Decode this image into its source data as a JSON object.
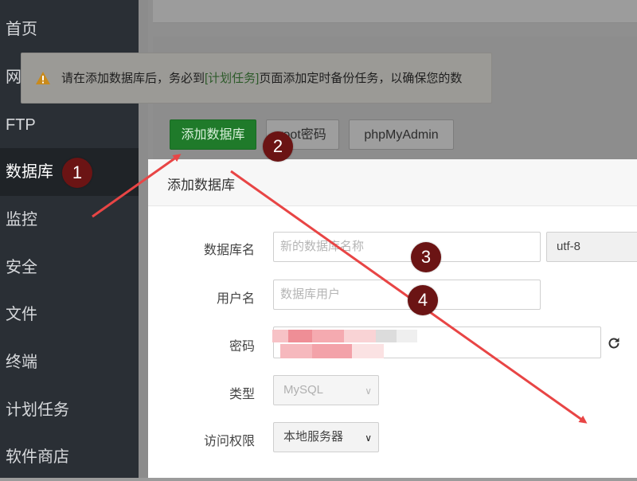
{
  "sidebar": {
    "items": [
      {
        "label": "首页"
      },
      {
        "label": "网站"
      },
      {
        "label": "FTP"
      },
      {
        "label": "数据库",
        "active": true
      },
      {
        "label": "监控"
      },
      {
        "label": "安全"
      },
      {
        "label": "文件"
      },
      {
        "label": "终端"
      },
      {
        "label": "计划任务"
      },
      {
        "label": "软件商店"
      }
    ]
  },
  "notice": {
    "icon": "warning-icon",
    "text_before": "请在添加数据库后，务必到",
    "link": "[计划任务]",
    "text_after": "页面添加定时备份任务，以确保您的数"
  },
  "toolbar": {
    "add_db_label": "添加数据库",
    "root_pw_label": "root密码",
    "pma_label": "phpMyAdmin"
  },
  "modal": {
    "title": "添加数据库",
    "fields": {
      "db_name_label": "数据库名",
      "db_name_placeholder": "新的数据库名称",
      "charset_value": "utf-8",
      "user_label": "用户名",
      "user_placeholder": "数据库用户",
      "password_label": "密码",
      "type_label": "类型",
      "type_value": "MySQL",
      "access_label": "访问权限",
      "access_value": "本地服务器"
    }
  },
  "annotations": [
    "1",
    "2",
    "3",
    "4"
  ],
  "colors": {
    "accent_green": "#1f7a2a",
    "badge": "#6b1414",
    "arrow": "#e84545",
    "warning": "#c98a1b"
  }
}
